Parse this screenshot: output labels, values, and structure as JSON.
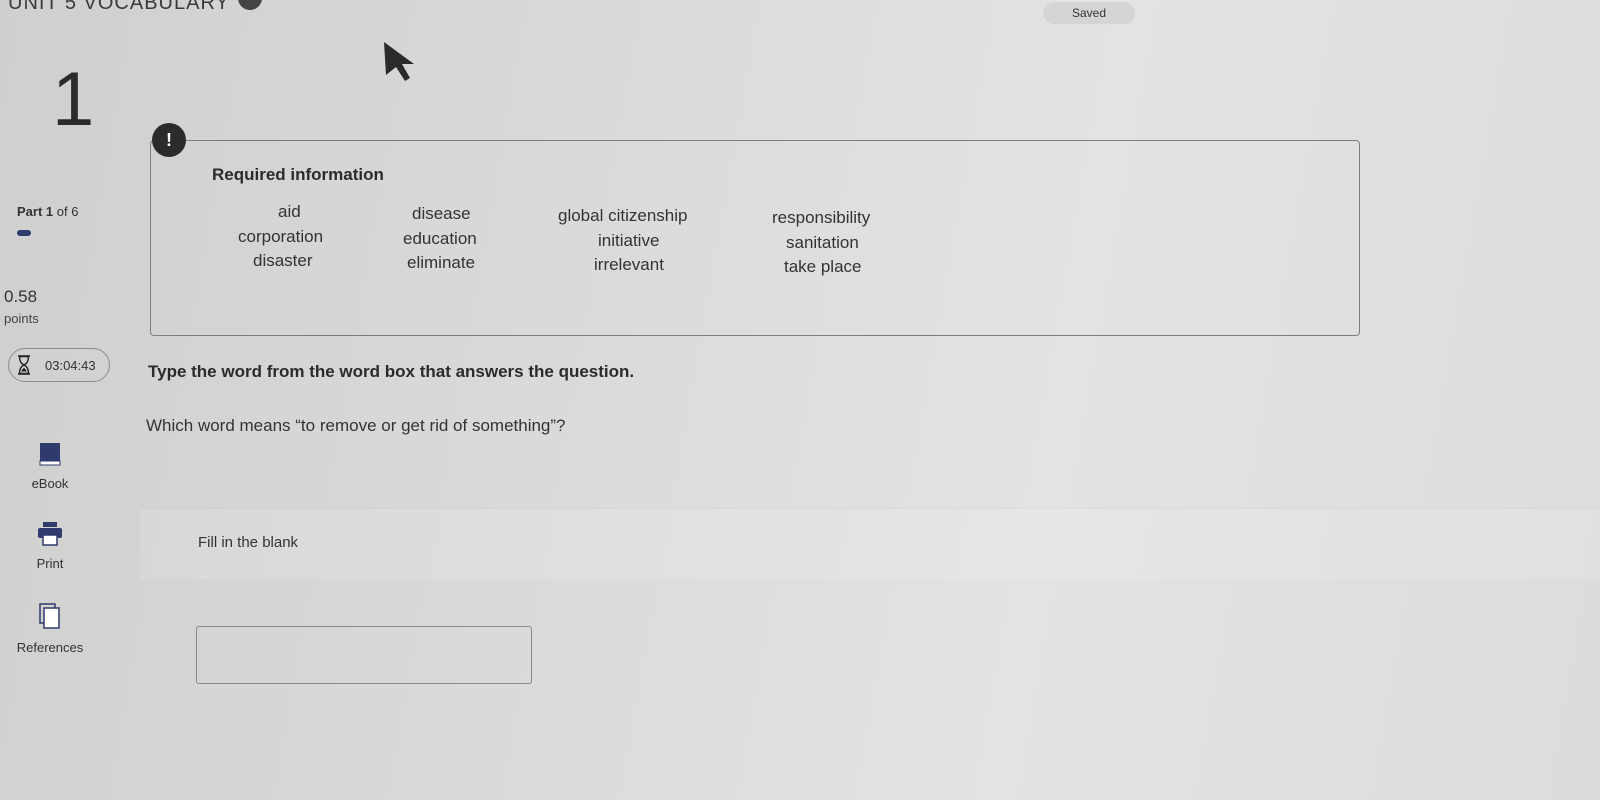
{
  "header": {
    "unit_title": "UNIT 5 VOCABULARY",
    "saved_label": "Saved"
  },
  "question": {
    "number": "1",
    "part_label": "Part",
    "part_current": "1",
    "part_of": "of 6",
    "part_progress_fraction": 0.17,
    "points_value": "0.58",
    "points_label": "points",
    "timer": "03:04:43",
    "instruction": "Type the word from the word box that answers the question.",
    "prompt": "Which word means “to remove or get rid of something”?",
    "fill_label": "Fill in the blank",
    "answer_value": ""
  },
  "required_info": {
    "exclaim": "!",
    "title": "Required information",
    "words": [
      [
        "aid",
        "disease",
        "global citizenship",
        "responsibility"
      ],
      [
        "corporation",
        "education",
        "initiative",
        "sanitation"
      ],
      [
        "disaster",
        "eliminate",
        "irrelevant",
        "take place"
      ]
    ]
  },
  "tools": {
    "ebook": "eBook",
    "print": "Print",
    "references": "References"
  },
  "colors": {
    "accent": "#2f3b6c",
    "text": "#2b2b2b"
  }
}
